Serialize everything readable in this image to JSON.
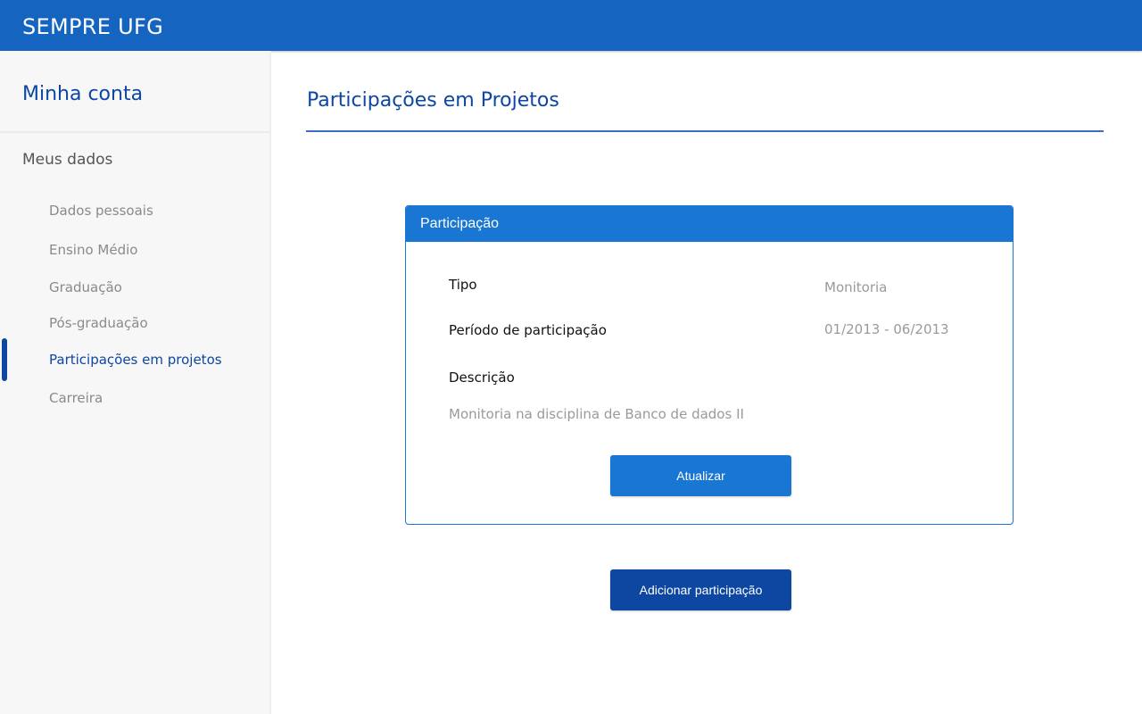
{
  "app": {
    "title": "SEMPRE UFG"
  },
  "sidebar": {
    "account_title": "Minha conta",
    "section_title": "Meus dados",
    "items": [
      {
        "label": "Dados pessoais"
      },
      {
        "label": "Ensino Médio"
      },
      {
        "label": "Graduação"
      },
      {
        "label": "Pós-graduação"
      },
      {
        "label": "Participações em projetos"
      },
      {
        "label": "Carreira"
      }
    ]
  },
  "main": {
    "page_title": "Participações em Projetos",
    "card": {
      "header": "Participação",
      "tipo_label": "Tipo",
      "tipo_value": "Monitoria",
      "periodo_label": "Período de participação",
      "periodo_value": "01/2013 - 06/2013",
      "descricao_label": "Descrição",
      "descricao_value": "Monitoria na disciplina de Banco de dados II",
      "update_button": "Atualizar"
    },
    "add_button": "Adicionar participação"
  },
  "colors": {
    "primary": "#1565c0",
    "accent": "#1976d2",
    "dark_accent": "#0d47a1"
  }
}
